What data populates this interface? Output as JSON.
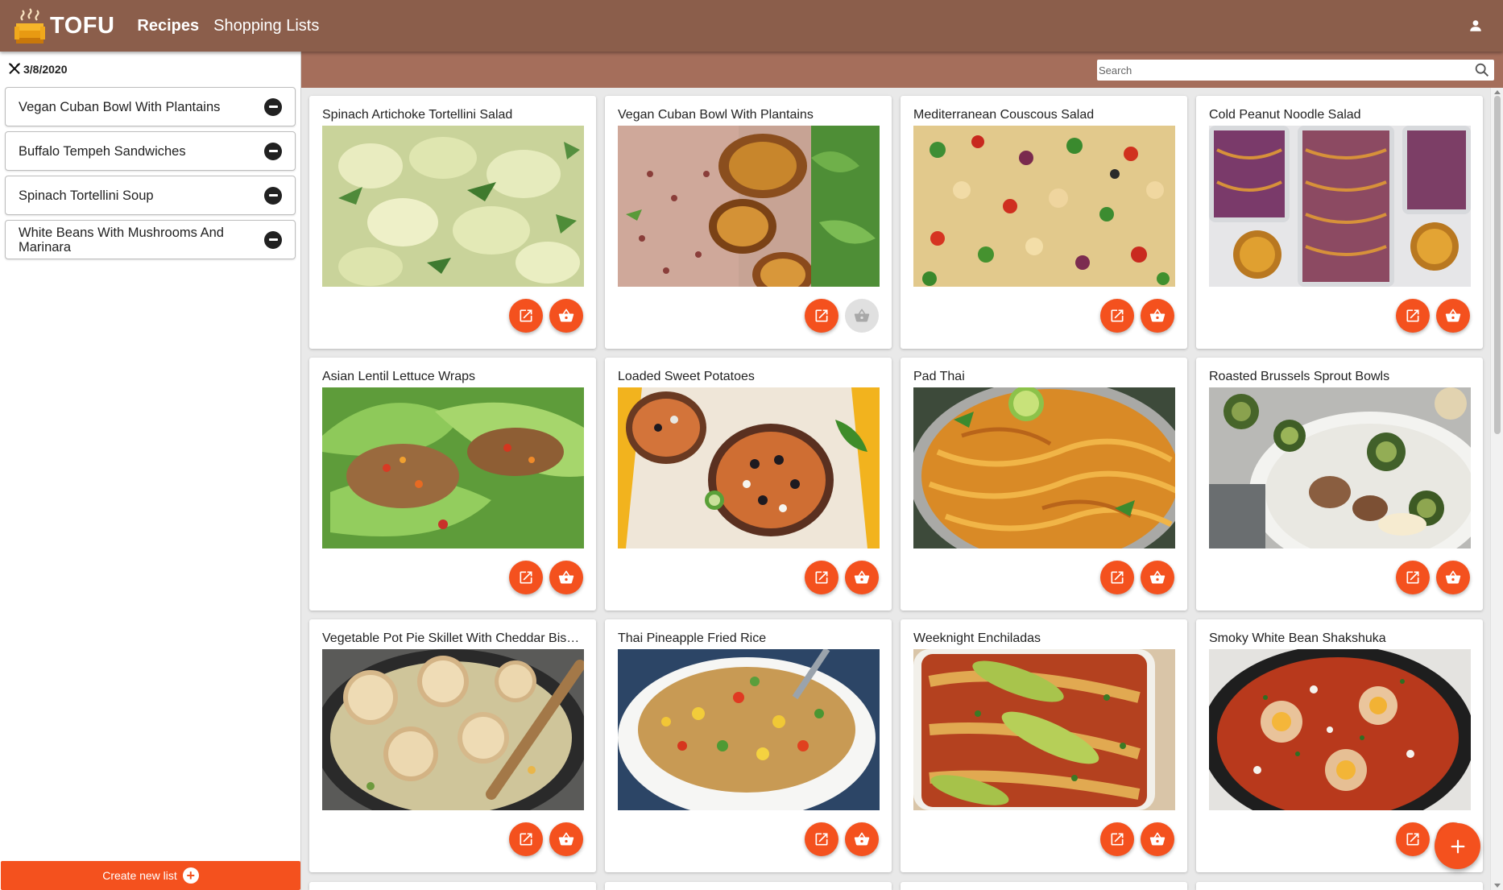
{
  "app": {
    "brand": "TOFU",
    "nav": [
      {
        "label": "Recipes",
        "active": true
      },
      {
        "label": "Shopping Lists",
        "active": false
      }
    ],
    "colors": {
      "header": "#8b5e4b",
      "subheader": "#a56e5b",
      "accent": "#f4511e"
    }
  },
  "sidebar": {
    "date": "3/8/2020",
    "date_icon": "utensils-icon",
    "items": [
      {
        "label": "Vegan Cuban Bowl With Plantains"
      },
      {
        "label": "Buffalo Tempeh Sandwiches"
      },
      {
        "label": "Spinach Tortellini Soup"
      },
      {
        "label": "White Beans With Mushrooms And Marinara"
      }
    ],
    "create_button": "Create new list"
  },
  "search": {
    "placeholder": "Search",
    "value": ""
  },
  "recipes": [
    {
      "title": "Spinach Artichoke Tortellini Salad",
      "cart_enabled": true
    },
    {
      "title": "Vegan Cuban Bowl With Plantains",
      "cart_enabled": false
    },
    {
      "title": "Mediterranean Couscous Salad",
      "cart_enabled": true
    },
    {
      "title": "Cold Peanut Noodle Salad",
      "cart_enabled": true
    },
    {
      "title": "Asian Lentil Lettuce Wraps",
      "cart_enabled": true
    },
    {
      "title": "Loaded Sweet Potatoes",
      "cart_enabled": true
    },
    {
      "title": "Pad Thai",
      "cart_enabled": true
    },
    {
      "title": "Roasted Brussels Sprout Bowls",
      "cart_enabled": true
    },
    {
      "title": "Vegetable Pot Pie Skillet With Cheddar Biscuits",
      "cart_enabled": true
    },
    {
      "title": "Thai Pineapple Fried Rice",
      "cart_enabled": true
    },
    {
      "title": "Weeknight Enchiladas",
      "cart_enabled": true
    },
    {
      "title": "Smoky White Bean Shakshuka",
      "cart_enabled": true
    }
  ]
}
